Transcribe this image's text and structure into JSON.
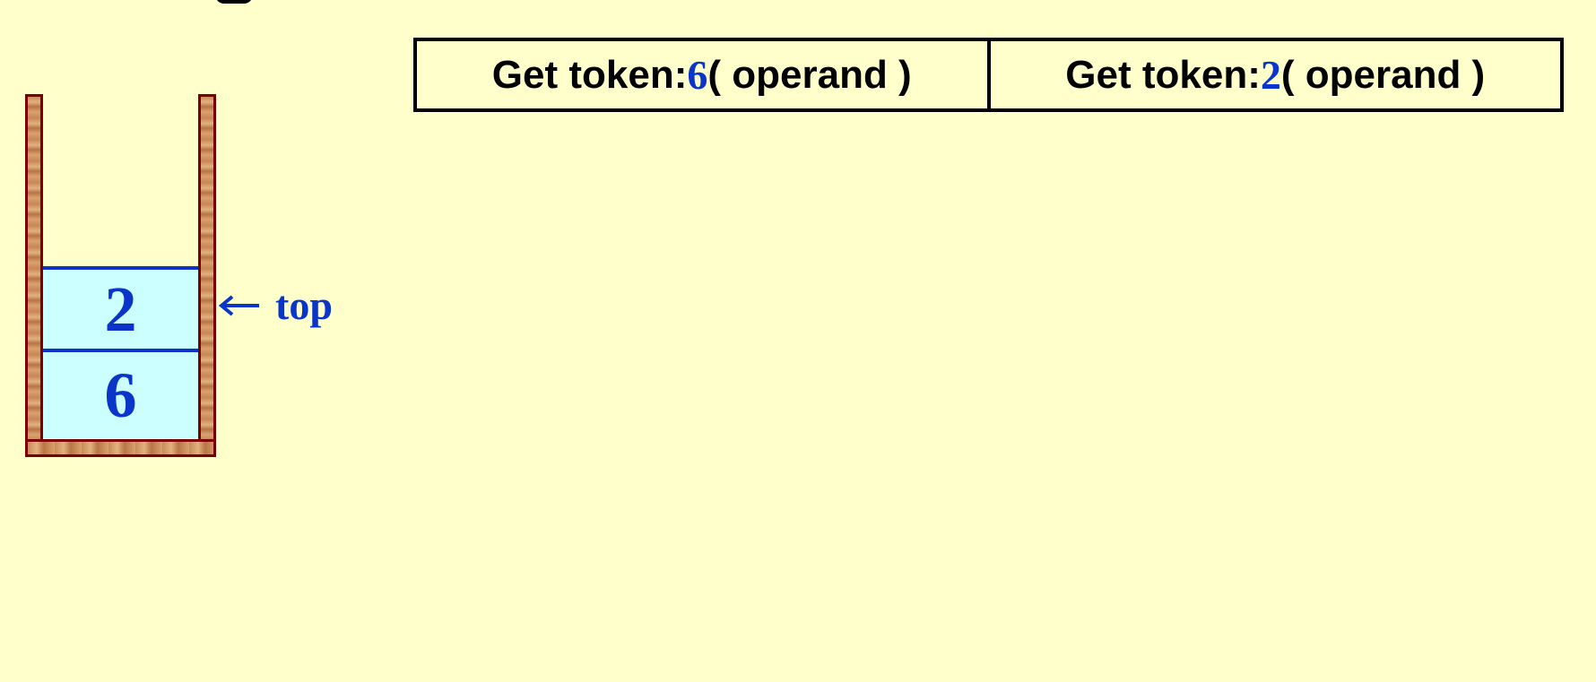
{
  "tokens": [
    {
      "prefix": "Get token: ",
      "value": "6",
      "suffix": " ( operand )"
    },
    {
      "prefix": "Get token: ",
      "value": "2",
      "suffix": " ( operand )"
    }
  ],
  "stack": {
    "items_top_to_bottom": [
      "2",
      "6"
    ],
    "pointer_label": "top"
  },
  "colors": {
    "background": "#ffffcc",
    "accent": "#0a35c8",
    "stack_cell": "#ccffff",
    "stack_wall": "#c98a5a",
    "stack_border": "#7a0000"
  },
  "icons": {
    "pointer": "left-arrow-icon"
  }
}
